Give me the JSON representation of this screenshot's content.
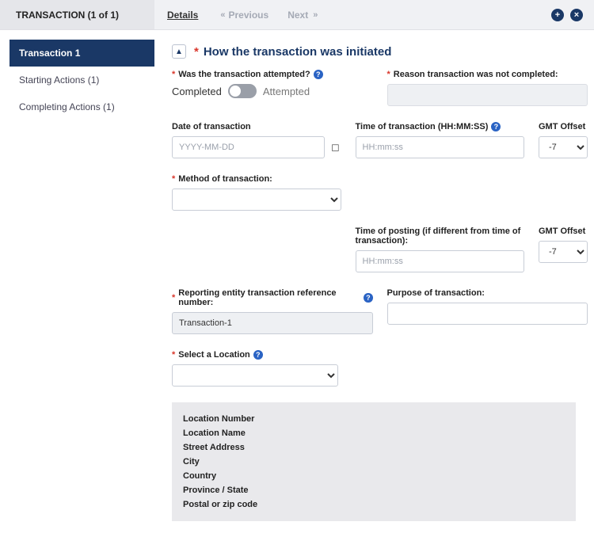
{
  "header": {
    "title": "TRANSACTION (1 of 1)",
    "details_tab": "Details",
    "prev": "Previous",
    "next": "Next"
  },
  "sidebar": {
    "items": [
      {
        "label": "Transaction 1"
      },
      {
        "label": "Starting Actions (1)"
      },
      {
        "label": "Completing Actions (1)"
      }
    ]
  },
  "section": {
    "title": "How the transaction was initiated"
  },
  "form": {
    "attempted_label": "Was the transaction attempted?",
    "toggle_left": "Completed",
    "toggle_right": "Attempted",
    "reason_label": "Reason transaction was not completed:",
    "date_label": "Date of transaction",
    "date_placeholder": "YYYY-MM-DD",
    "time_label": "Time of transaction (HH:MM:SS)",
    "time_placeholder": "HH:mm:ss",
    "gmt_label": "GMT Offset",
    "gmt_value": "-7",
    "method_label": "Method of transaction:",
    "posting_label": "Time of posting (if different from time of transaction):",
    "posting_placeholder": "HH:mm:ss",
    "gmt2_value": "-7",
    "ref_label": "Reporting entity transaction reference number:",
    "ref_value": "Transaction-1",
    "purpose_label": "Purpose of transaction:",
    "location_label": "Select a Location"
  },
  "location_box": {
    "l1": "Location Number",
    "l2": "Location Name",
    "l3": "Street Address",
    "l4": "City",
    "l5": "Country",
    "l6": "Province / State",
    "l7": "Postal or zip code"
  }
}
